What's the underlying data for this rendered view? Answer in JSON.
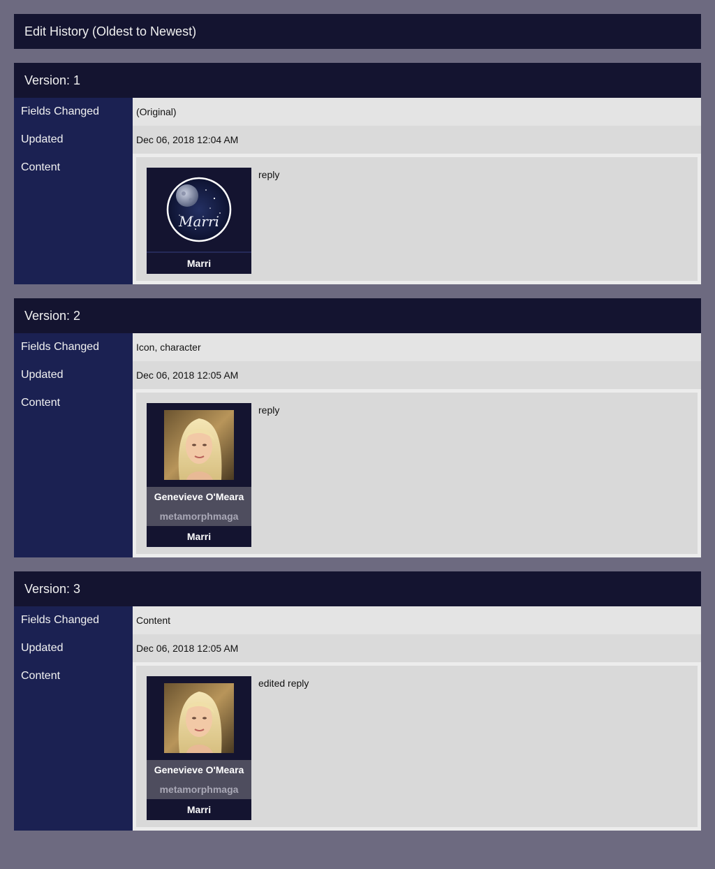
{
  "page": {
    "title": "Edit History (Oldest to Newest)"
  },
  "labels": {
    "fields_changed": "Fields Changed",
    "updated": "Updated",
    "content": "Content"
  },
  "versions": [
    {
      "header": "Version: 1",
      "fields_changed": "(Original)",
      "updated": "Dec 06, 2018 12:04 AM",
      "author": "Marri",
      "icon": "marri-moon-avatar-icon",
      "icon_text": "Marri",
      "text": "reply"
    },
    {
      "header": "Version: 2",
      "fields_changed": "Icon, character",
      "updated": "Dec 06, 2018 12:05 AM",
      "character": "Genevieve O'Meara",
      "screenname": "metamorphmaga",
      "author": "Marri",
      "icon": "blonde-woman-avatar-icon",
      "text": "reply"
    },
    {
      "header": "Version: 3",
      "fields_changed": "Content",
      "updated": "Dec 06, 2018 12:05 AM",
      "character": "Genevieve O'Meara",
      "screenname": "metamorphmaga",
      "author": "Marri",
      "icon": "blonde-woman-avatar-icon",
      "text": "edited reply"
    }
  ]
}
